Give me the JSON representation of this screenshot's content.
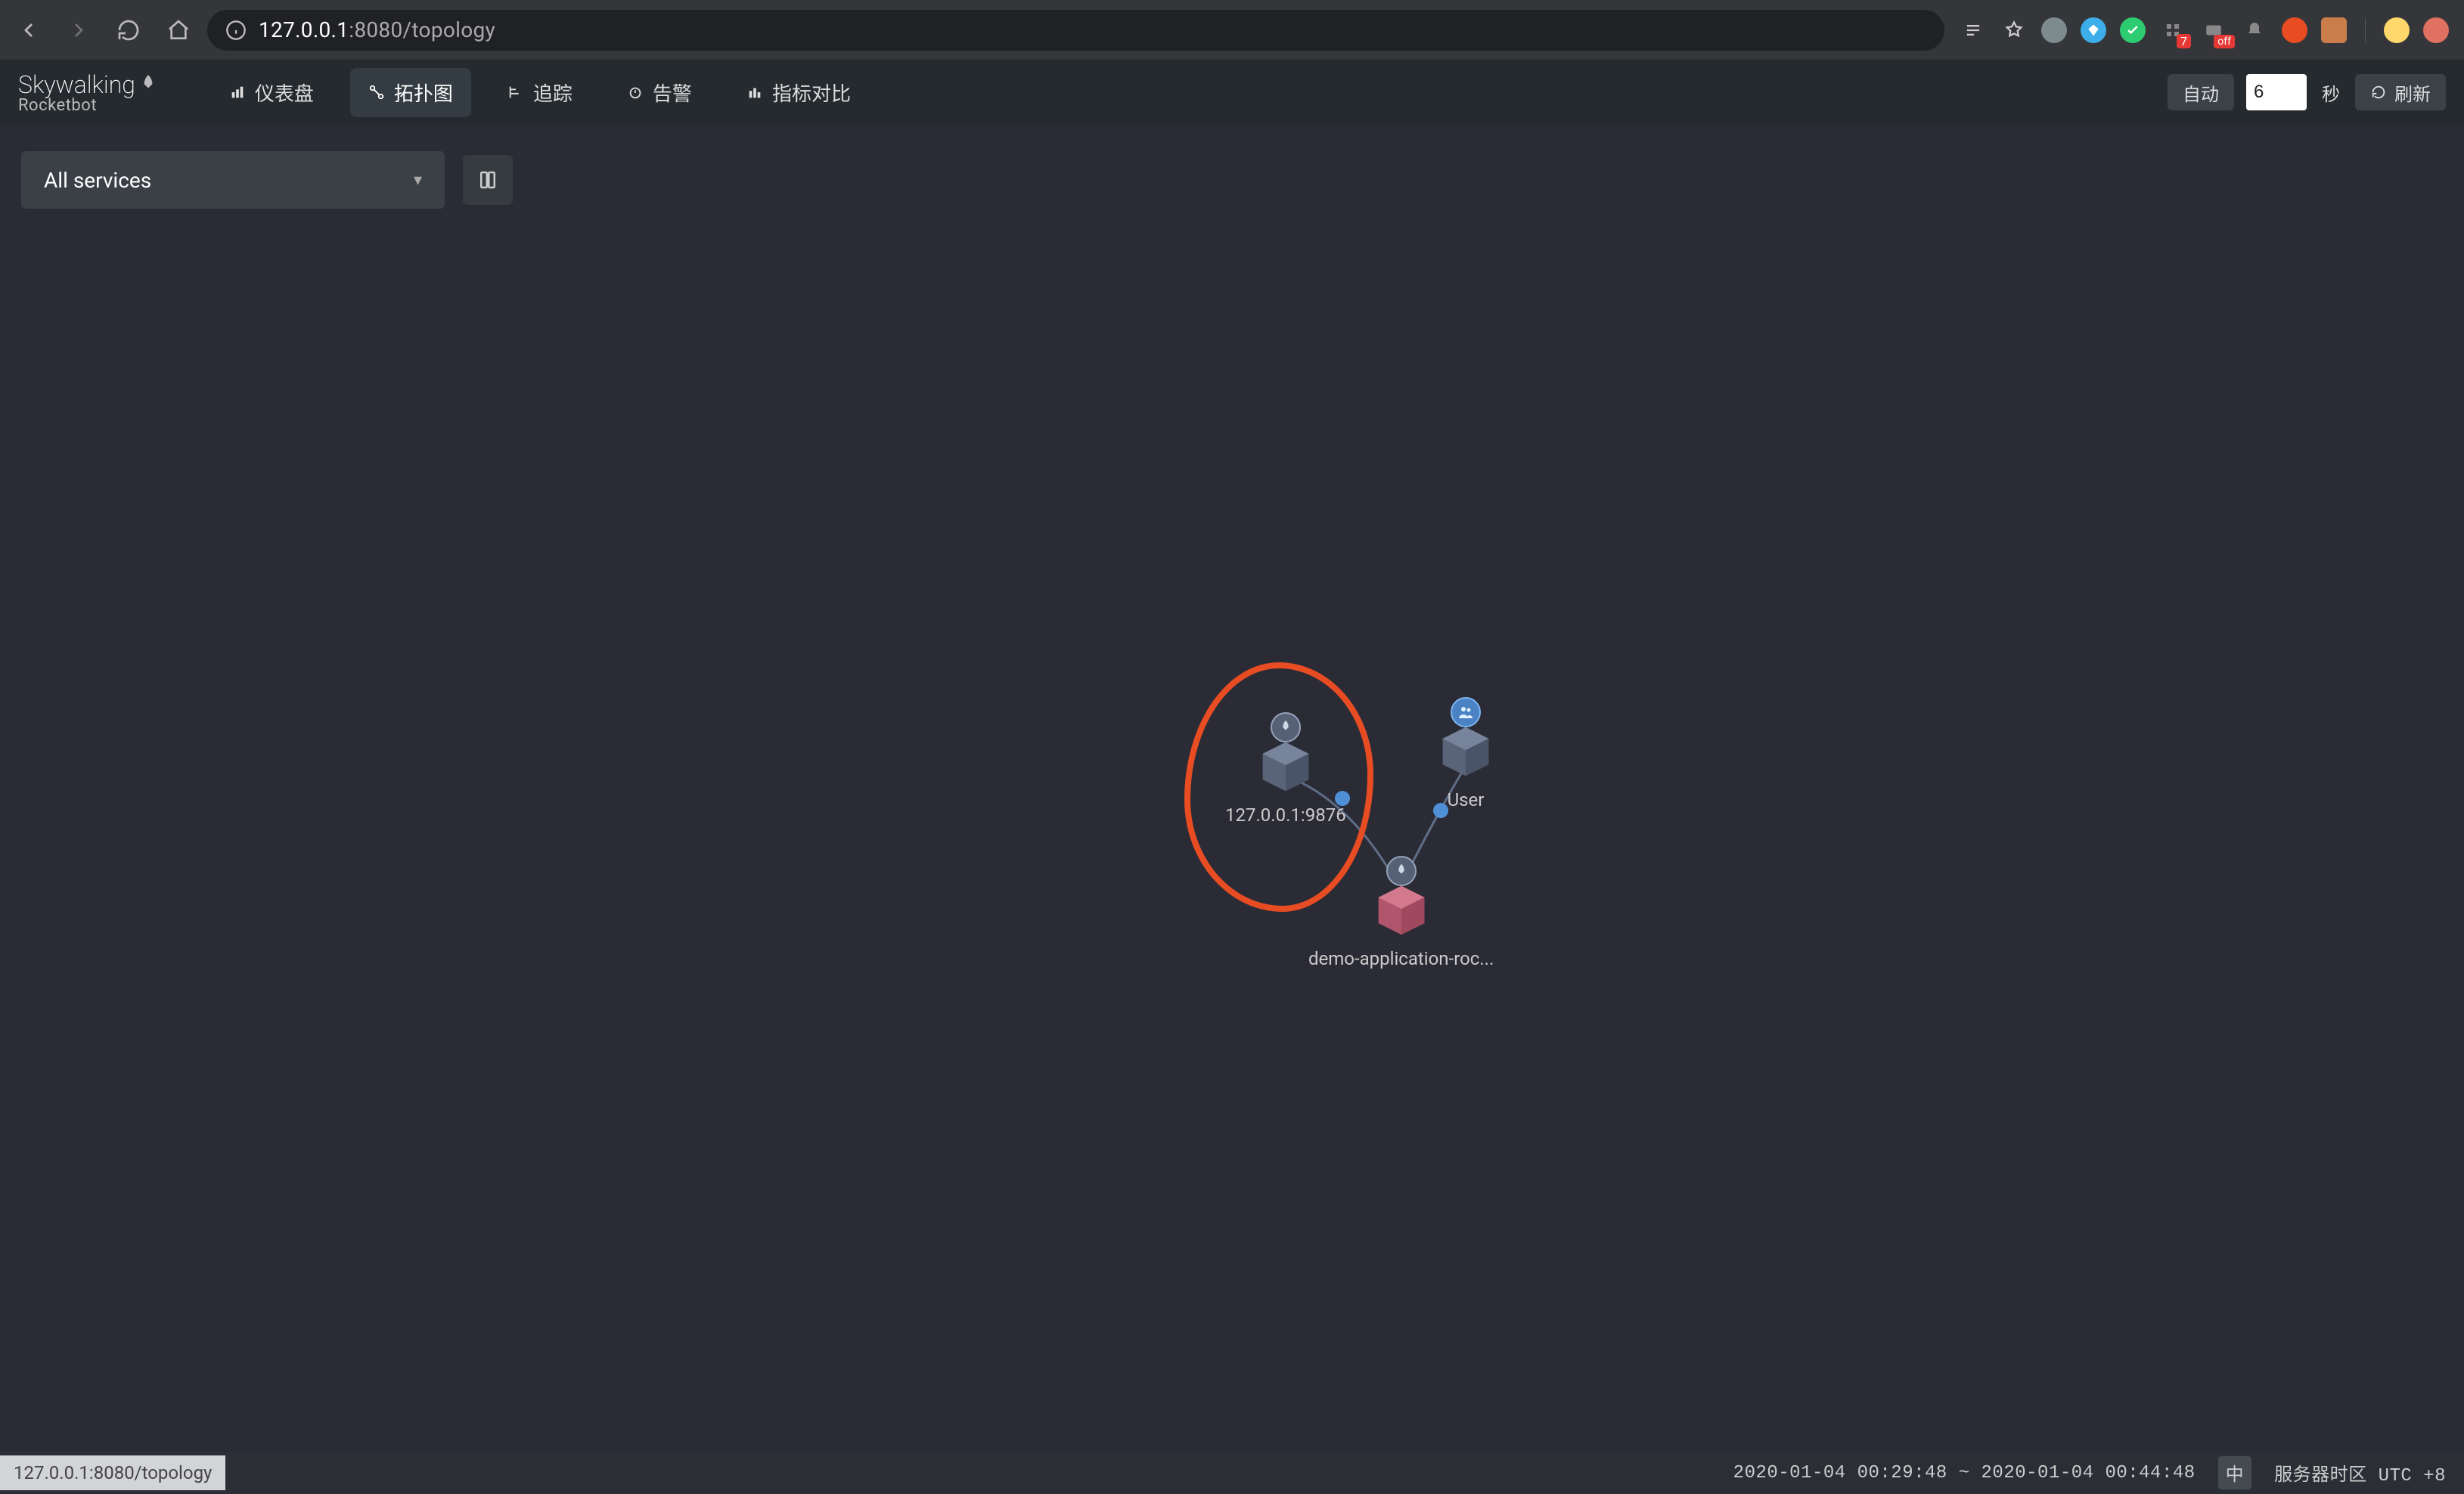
{
  "browser": {
    "url_host": "127.0.0.1",
    "url_port_path": ":8080/topology"
  },
  "logo": {
    "top": "Skywalking",
    "sub": "Rocketbot"
  },
  "nav": {
    "dashboard": "仪表盘",
    "topology": "拓扑图",
    "trace": "追踪",
    "alarm": "告警",
    "metrics": "指标对比"
  },
  "header_right": {
    "auto": "自动",
    "interval_value": "6",
    "seconds_label": "秒",
    "refresh": "刷新"
  },
  "toolbar": {
    "service_select": "All services"
  },
  "topology": {
    "node_left_label": "127.0.0.1:9876",
    "node_right_label": "User",
    "node_bottom_label": "demo-application-roc..."
  },
  "status": {
    "hover_url": "127.0.0.1:8080/topology",
    "time_range": "2020-01-04 00:29:48 ~ 2020-01-04 00:44:48",
    "lang": "中",
    "tz_label": "服务器时区 UTC",
    "tz_offset": "+8"
  }
}
